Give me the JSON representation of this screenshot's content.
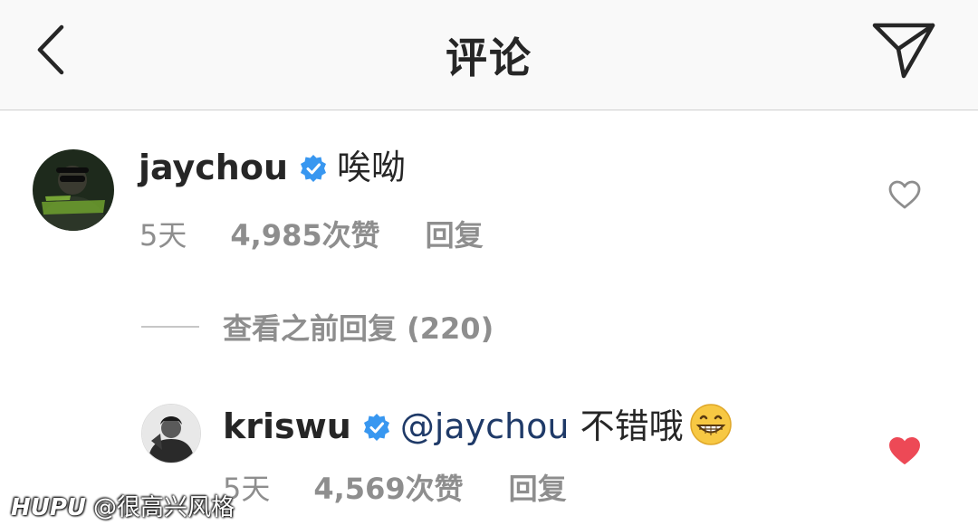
{
  "header": {
    "back_icon": "chevron-left-icon",
    "title": "评论",
    "share_icon": "paper-plane-icon"
  },
  "comments": [
    {
      "username": "jaychou",
      "verified": true,
      "text": "唉呦",
      "time": "5天",
      "likes": "4,985次赞",
      "reply_label": "回复",
      "liked": false
    },
    {
      "username": "kriswu",
      "verified": true,
      "mention": "@jaychou",
      "text": "不错哦",
      "emoji": "grinning-face-icon",
      "time": "5天",
      "likes": "4,569次赞",
      "reply_label": "回复",
      "liked": true
    }
  ],
  "view_previous": "查看之前回复 (220)",
  "watermark": {
    "brand": "HUPU",
    "handle": "@很高兴风格"
  },
  "colors": {
    "header_bg": "#f9f9f9",
    "verified_blue": "#3897f0",
    "heart_red": "#ed4956",
    "meta_gray": "#8e8e8e",
    "mention_blue": "#1f3a68"
  }
}
